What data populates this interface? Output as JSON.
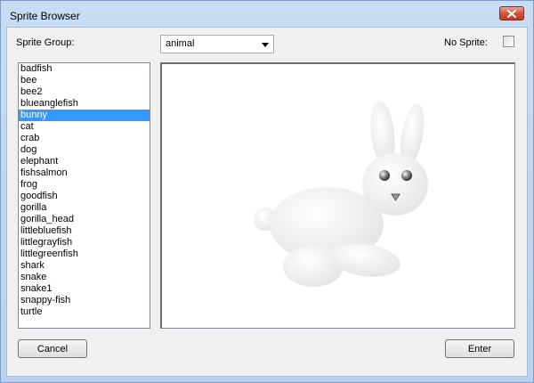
{
  "window": {
    "title": "Sprite Browser"
  },
  "form": {
    "group_label": "Sprite Group:",
    "group_value": "animal",
    "no_sprite_label": "No Sprite:",
    "no_sprite_checked": false
  },
  "list": {
    "items": [
      "badfish",
      "bee",
      "bee2",
      "blueanglefish",
      "bunny",
      "cat",
      "crab",
      "dog",
      "elephant",
      "fishsalmon",
      "frog",
      "goodfish",
      "gorilla",
      "gorilla_head",
      "littlebluefish",
      "littlegrayfish",
      "littlegreenfish",
      "shark",
      "snake",
      "snake1",
      "snappy-fish",
      "turtle"
    ],
    "selected": "bunny"
  },
  "preview": {
    "sprite": "bunny",
    "icon": "bunny-sprite-icon"
  },
  "buttons": {
    "cancel": "Cancel",
    "enter": "Enter"
  },
  "colors": {
    "selection": "#3399ff",
    "close": "#c8412a"
  }
}
